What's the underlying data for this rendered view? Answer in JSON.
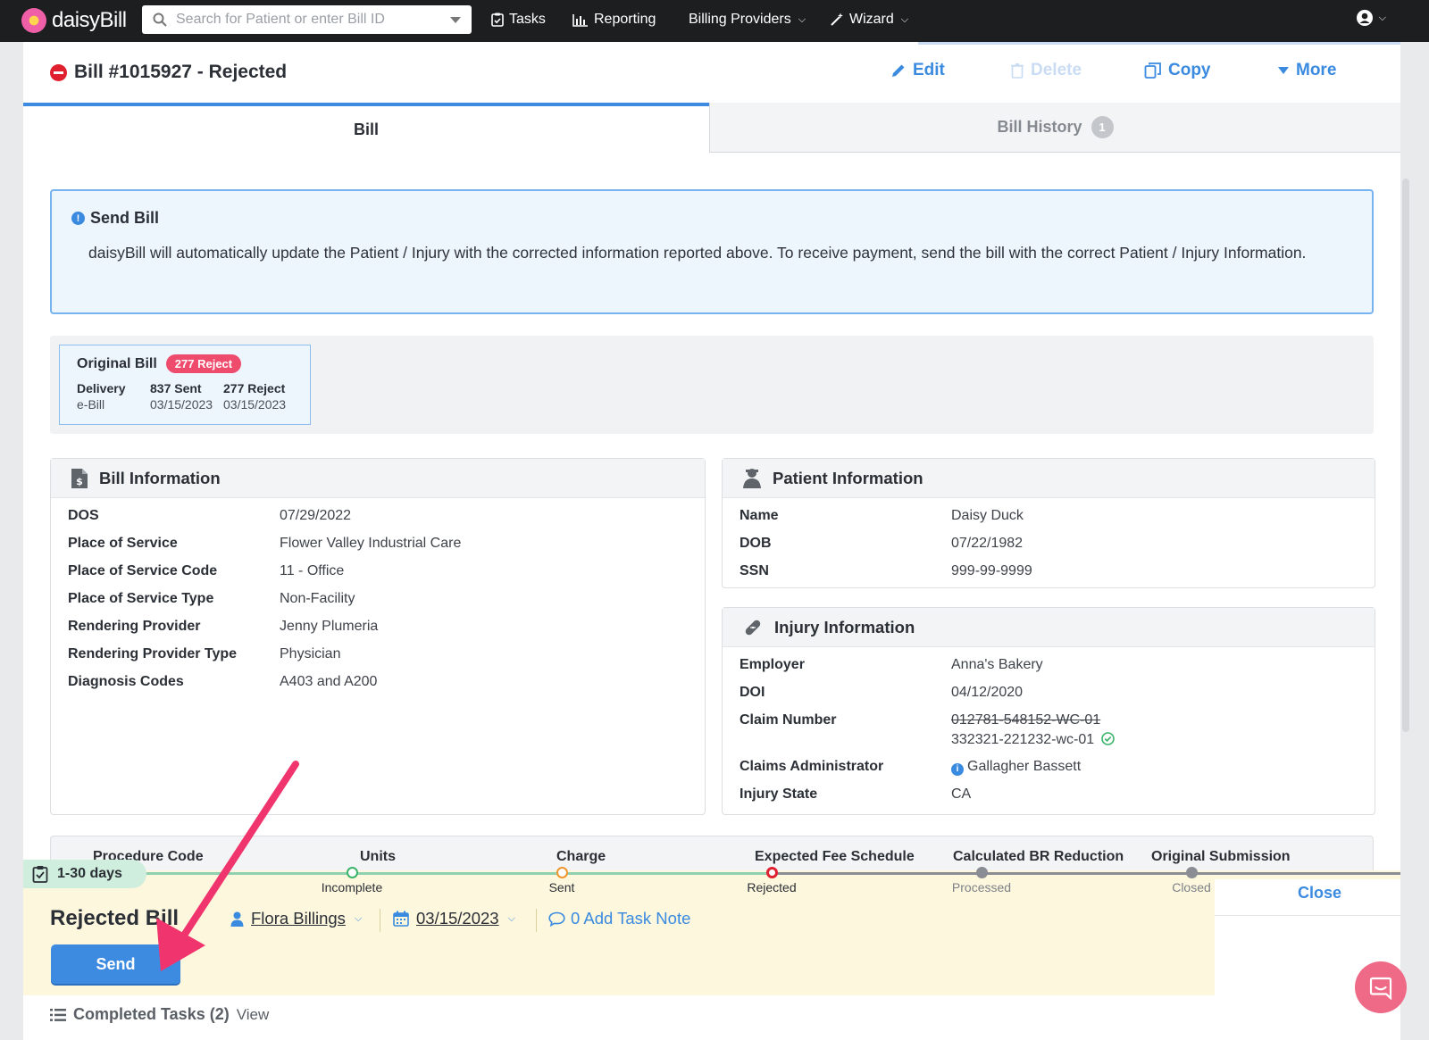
{
  "nav": {
    "logo": "daisyBill",
    "search_placeholder": "Search for Patient or enter Bill ID",
    "items": [
      {
        "label": "Tasks",
        "icon": "clipboard-check-icon"
      },
      {
        "label": "Reporting",
        "icon": "bar-chart-icon"
      },
      {
        "label": "Billing Providers",
        "icon": "chevron-down-icon"
      },
      {
        "label": "Wizard",
        "icon": "magic-wand-icon"
      }
    ]
  },
  "header": {
    "title": "Bill #1015927 - Rejected",
    "actions": {
      "edit": "Edit",
      "delete": "Delete",
      "copy": "Copy",
      "more": "More"
    }
  },
  "tabs": {
    "bill": "Bill",
    "history": "Bill History",
    "history_count": "1"
  },
  "alert": {
    "title": "Send Bill",
    "text": "daisyBill will automatically update the Patient / Injury with the corrected information reported above. To receive payment, send the bill with the correct Patient / Injury Information."
  },
  "original_bill": {
    "title": "Original Bill",
    "badge": "277 Reject",
    "columns": [
      {
        "label": "Delivery",
        "value": "e-Bill"
      },
      {
        "label": "837 Sent",
        "value": "03/15/2023"
      },
      {
        "label": "277 Reject",
        "value": "03/15/2023"
      }
    ]
  },
  "bill_info": {
    "title": "Bill Information",
    "rows": [
      {
        "label": "DOS",
        "value": "07/29/2022"
      },
      {
        "label": "Place of Service",
        "value": "Flower Valley Industrial Care"
      },
      {
        "label": "Place of Service Code",
        "value": "11 - Office"
      },
      {
        "label": "Place of Service Type",
        "value": "Non-Facility"
      },
      {
        "label": "Rendering Provider",
        "value": "Jenny Plumeria"
      },
      {
        "label": "Rendering Provider Type",
        "value": "Physician"
      },
      {
        "label": "Diagnosis Codes",
        "value": "A403 and A200"
      }
    ]
  },
  "patient_info": {
    "title": "Patient Information",
    "rows": [
      {
        "label": "Name",
        "value": "Daisy Duck"
      },
      {
        "label": "DOB",
        "value": "07/22/1982"
      },
      {
        "label": "SSN",
        "value": "999-99-9999"
      }
    ]
  },
  "injury_info": {
    "title": "Injury Information",
    "employer_label": "Employer",
    "employer": "Anna's Bakery",
    "doi_label": "DOI",
    "doi": "04/12/2020",
    "claim_label": "Claim Number",
    "claim_old": "012781-548152-WC-01",
    "claim_new": "332321-221232-wc-01",
    "admin_label": "Claims Administrator",
    "admin": "Gallagher Bassett",
    "state_label": "Injury State",
    "state": "CA"
  },
  "table_headers": [
    "Procedure Code",
    "Units",
    "Charge",
    "Expected Fee Schedule",
    "Calculated BR Reduction",
    "Original Submission"
  ],
  "taskbar": {
    "days": "1-30 days",
    "steps": [
      "Incomplete",
      "Sent",
      "Rejected",
      "Processed",
      "Closed"
    ],
    "close": "Close",
    "title": "Rejected Bill",
    "assignee": "Flora Billings",
    "date": "03/15/2023",
    "task_note": "0 Add Task Note",
    "send": "Send",
    "completed": "Completed Tasks (2)",
    "view": "View"
  },
  "colors": {
    "accent": "#3d8be0",
    "reject": "#e0202e",
    "badge": "#ef4b6c",
    "taskbar": "#fdf7dd",
    "annotation_arrow": "#f0356e"
  }
}
